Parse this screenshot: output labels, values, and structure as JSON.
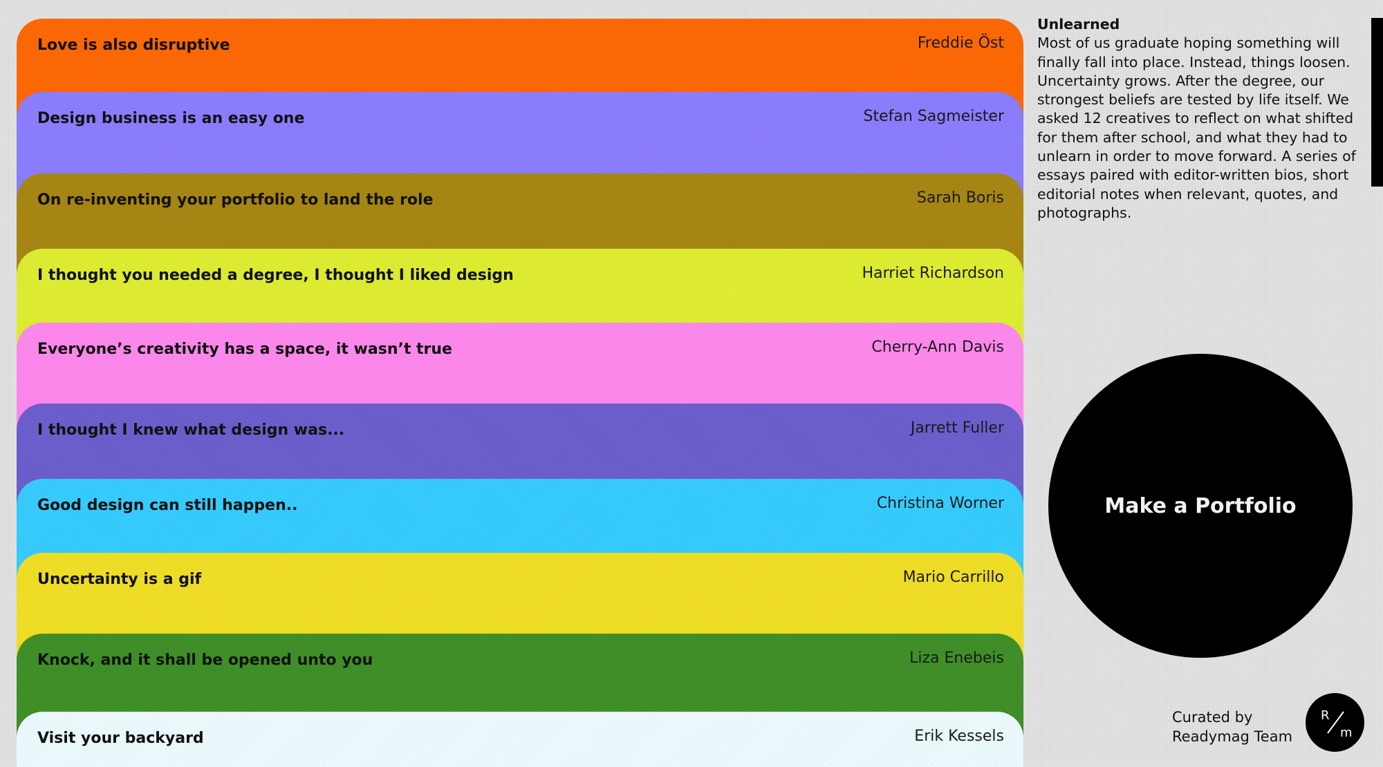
{
  "essays": [
    {
      "title": "Love is also disruptive",
      "author": "Freddie Öst",
      "color": "#ff6600"
    },
    {
      "title": "Design business is an easy one",
      "author": "Stefan Sagmeister",
      "color": "#8a7cff"
    },
    {
      "title": "On re-inventing your portfolio to land the role",
      "author": "Sarah Boris",
      "color": "#a6850f"
    },
    {
      "title": "I thought you needed a degree, I thought I liked design",
      "author": "Harriet Richardson",
      "color": "#dfee2e"
    },
    {
      "title": "Everyone’s creativity has a space, it wasn’t true",
      "author": "Cherry-Ann Davis",
      "color": "#ff87ee"
    },
    {
      "title": "I thought I knew what design was...",
      "author": "Jarrett Fuller",
      "color": "#6a5ccc"
    },
    {
      "title": "Good design can still happen..",
      "author": "Christina Worner",
      "color": "#33ccff"
    },
    {
      "title": "Uncertainty is a gif",
      "author": "Mario Carrillo",
      "color": "#f1df22"
    },
    {
      "title": "Knock, and it shall be opened unto you",
      "author": "Liza Enebeis",
      "color": "#3c8e24"
    },
    {
      "title": "Visit your backyard",
      "author": "Erik Kessels",
      "color": "#eefcff"
    }
  ],
  "intro": {
    "title": "Unlearned",
    "body": "Most of us graduate hoping something will finally fall into place. Instead, things loosen. Uncertainty grows. After the degree, our strongest beliefs are tested by life itself. We asked 12 creatives to reflect on what shifted for them after school, and what they had to unlearn in order to move forward. A series of essays paired with editor-written bios, short editorial notes when relevant, quotes, and photographs."
  },
  "portfolio_button": {
    "label": "Make a Portfolio"
  },
  "credits": {
    "line1": "Curated by",
    "line2": "Readymag Team"
  },
  "logo": {
    "top_letter": "R",
    "bottom_letter": "m",
    "icon": "readymag-logo-icon"
  }
}
